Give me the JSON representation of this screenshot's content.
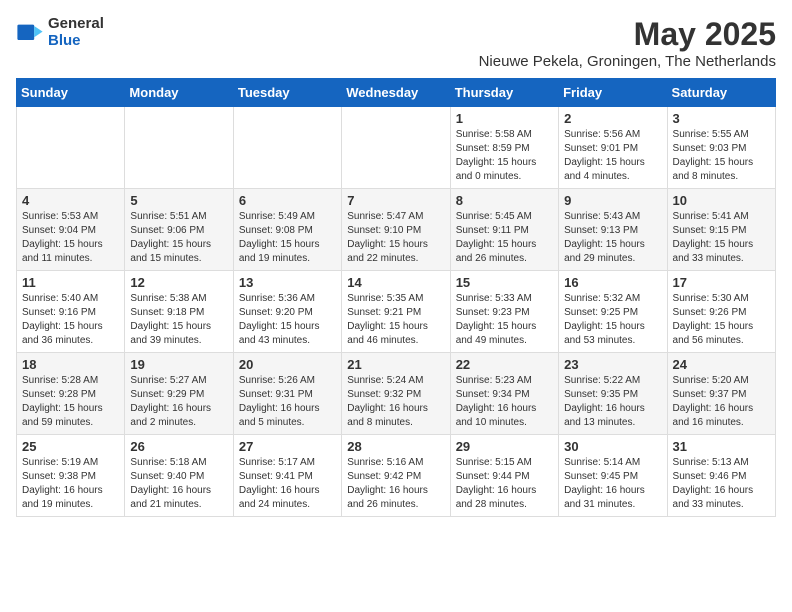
{
  "logo": {
    "general": "General",
    "blue": "Blue"
  },
  "title": {
    "month_year": "May 2025",
    "location": "Nieuwe Pekela, Groningen, The Netherlands"
  },
  "headers": [
    "Sunday",
    "Monday",
    "Tuesday",
    "Wednesday",
    "Thursday",
    "Friday",
    "Saturday"
  ],
  "weeks": [
    [
      {
        "day": "",
        "info": ""
      },
      {
        "day": "",
        "info": ""
      },
      {
        "day": "",
        "info": ""
      },
      {
        "day": "",
        "info": ""
      },
      {
        "day": "1",
        "info": "Sunrise: 5:58 AM\nSunset: 8:59 PM\nDaylight: 15 hours and 0 minutes."
      },
      {
        "day": "2",
        "info": "Sunrise: 5:56 AM\nSunset: 9:01 PM\nDaylight: 15 hours and 4 minutes."
      },
      {
        "day": "3",
        "info": "Sunrise: 5:55 AM\nSunset: 9:03 PM\nDaylight: 15 hours and 8 minutes."
      }
    ],
    [
      {
        "day": "4",
        "info": "Sunrise: 5:53 AM\nSunset: 9:04 PM\nDaylight: 15 hours and 11 minutes."
      },
      {
        "day": "5",
        "info": "Sunrise: 5:51 AM\nSunset: 9:06 PM\nDaylight: 15 hours and 15 minutes."
      },
      {
        "day": "6",
        "info": "Sunrise: 5:49 AM\nSunset: 9:08 PM\nDaylight: 15 hours and 19 minutes."
      },
      {
        "day": "7",
        "info": "Sunrise: 5:47 AM\nSunset: 9:10 PM\nDaylight: 15 hours and 22 minutes."
      },
      {
        "day": "8",
        "info": "Sunrise: 5:45 AM\nSunset: 9:11 PM\nDaylight: 15 hours and 26 minutes."
      },
      {
        "day": "9",
        "info": "Sunrise: 5:43 AM\nSunset: 9:13 PM\nDaylight: 15 hours and 29 minutes."
      },
      {
        "day": "10",
        "info": "Sunrise: 5:41 AM\nSunset: 9:15 PM\nDaylight: 15 hours and 33 minutes."
      }
    ],
    [
      {
        "day": "11",
        "info": "Sunrise: 5:40 AM\nSunset: 9:16 PM\nDaylight: 15 hours and 36 minutes."
      },
      {
        "day": "12",
        "info": "Sunrise: 5:38 AM\nSunset: 9:18 PM\nDaylight: 15 hours and 39 minutes."
      },
      {
        "day": "13",
        "info": "Sunrise: 5:36 AM\nSunset: 9:20 PM\nDaylight: 15 hours and 43 minutes."
      },
      {
        "day": "14",
        "info": "Sunrise: 5:35 AM\nSunset: 9:21 PM\nDaylight: 15 hours and 46 minutes."
      },
      {
        "day": "15",
        "info": "Sunrise: 5:33 AM\nSunset: 9:23 PM\nDaylight: 15 hours and 49 minutes."
      },
      {
        "day": "16",
        "info": "Sunrise: 5:32 AM\nSunset: 9:25 PM\nDaylight: 15 hours and 53 minutes."
      },
      {
        "day": "17",
        "info": "Sunrise: 5:30 AM\nSunset: 9:26 PM\nDaylight: 15 hours and 56 minutes."
      }
    ],
    [
      {
        "day": "18",
        "info": "Sunrise: 5:28 AM\nSunset: 9:28 PM\nDaylight: 15 hours and 59 minutes."
      },
      {
        "day": "19",
        "info": "Sunrise: 5:27 AM\nSunset: 9:29 PM\nDaylight: 16 hours and 2 minutes."
      },
      {
        "day": "20",
        "info": "Sunrise: 5:26 AM\nSunset: 9:31 PM\nDaylight: 16 hours and 5 minutes."
      },
      {
        "day": "21",
        "info": "Sunrise: 5:24 AM\nSunset: 9:32 PM\nDaylight: 16 hours and 8 minutes."
      },
      {
        "day": "22",
        "info": "Sunrise: 5:23 AM\nSunset: 9:34 PM\nDaylight: 16 hours and 10 minutes."
      },
      {
        "day": "23",
        "info": "Sunrise: 5:22 AM\nSunset: 9:35 PM\nDaylight: 16 hours and 13 minutes."
      },
      {
        "day": "24",
        "info": "Sunrise: 5:20 AM\nSunset: 9:37 PM\nDaylight: 16 hours and 16 minutes."
      }
    ],
    [
      {
        "day": "25",
        "info": "Sunrise: 5:19 AM\nSunset: 9:38 PM\nDaylight: 16 hours and 19 minutes."
      },
      {
        "day": "26",
        "info": "Sunrise: 5:18 AM\nSunset: 9:40 PM\nDaylight: 16 hours and 21 minutes."
      },
      {
        "day": "27",
        "info": "Sunrise: 5:17 AM\nSunset: 9:41 PM\nDaylight: 16 hours and 24 minutes."
      },
      {
        "day": "28",
        "info": "Sunrise: 5:16 AM\nSunset: 9:42 PM\nDaylight: 16 hours and 26 minutes."
      },
      {
        "day": "29",
        "info": "Sunrise: 5:15 AM\nSunset: 9:44 PM\nDaylight: 16 hours and 28 minutes."
      },
      {
        "day": "30",
        "info": "Sunrise: 5:14 AM\nSunset: 9:45 PM\nDaylight: 16 hours and 31 minutes."
      },
      {
        "day": "31",
        "info": "Sunrise: 5:13 AM\nSunset: 9:46 PM\nDaylight: 16 hours and 33 minutes."
      }
    ]
  ]
}
